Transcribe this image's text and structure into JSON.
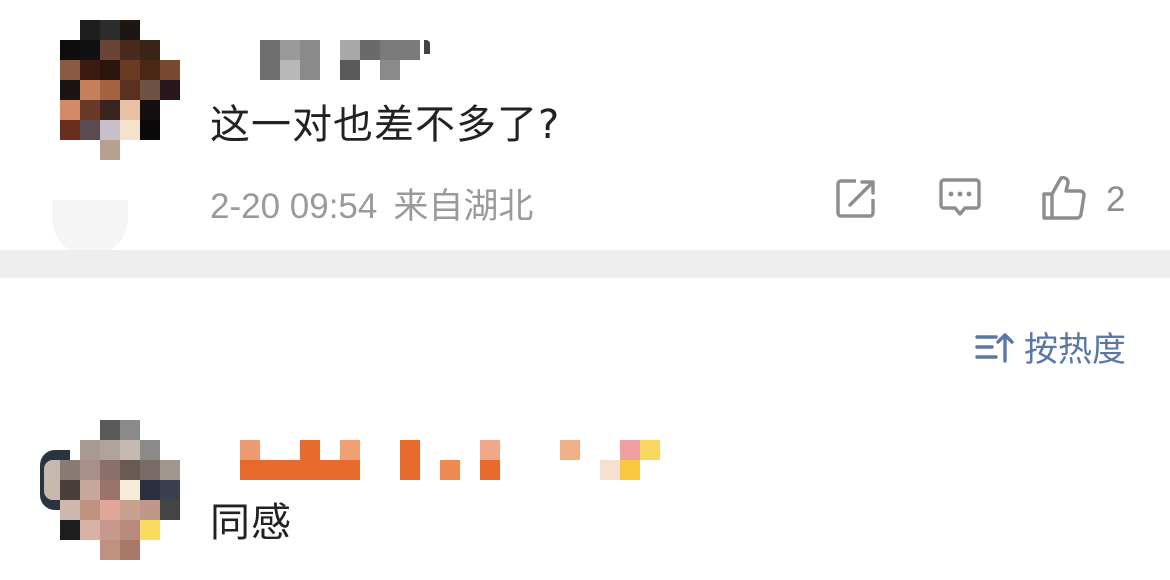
{
  "comment1": {
    "text": "这一对也差不多了?",
    "time": "2-20 09:54",
    "location": "来自湖北",
    "like_count": "2",
    "icons": [
      "share-icon",
      "reply-icon",
      "thumbs-up-icon"
    ]
  },
  "sort": {
    "label": "按热度",
    "icon": "sort-icon"
  },
  "comment2": {
    "text": "同感"
  },
  "colors": {
    "text": "#222222",
    "meta": "#9a9a9a",
    "accent": "#5b77a6",
    "divider": "#eeeeee",
    "username_orange": "#e8692c"
  }
}
